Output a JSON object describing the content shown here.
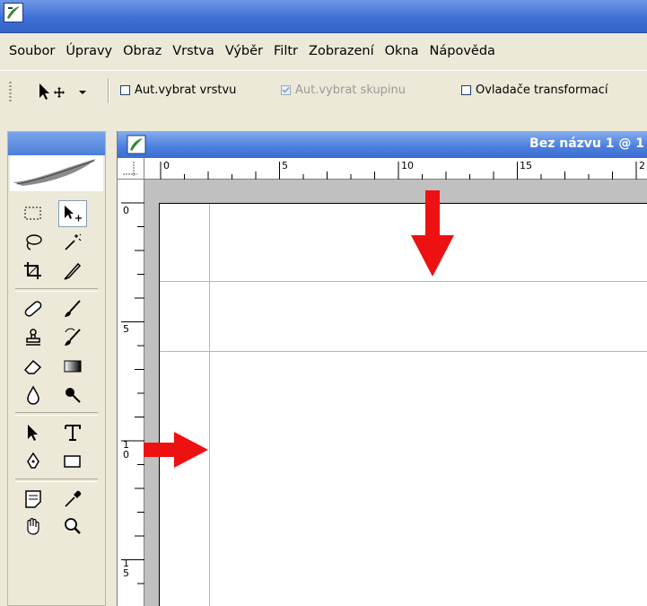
{
  "menu": [
    "Soubor",
    "Úpravy",
    "Obraz",
    "Vrstva",
    "Výběr",
    "Filtr",
    "Zobrazení",
    "Okna",
    "Nápověda"
  ],
  "options": {
    "auto_select_layer": "Aut.vybrat vrstvu",
    "auto_select_group": "Aut.vybrat skupinu",
    "transform_controls": "Ovladače transformací"
  },
  "document": {
    "title": "Bez názvu 1 @ 1"
  },
  "rulers": {
    "horizontal_labels": [
      "0",
      "5",
      "10",
      "15",
      "2"
    ],
    "vertical_labels": [
      "0",
      "5",
      "1\n0",
      "1\n5"
    ]
  },
  "colors": {
    "title_bar": "#3f6fd4",
    "guide": "#41e8e8",
    "arrow": "#ee1111",
    "chrome": "#ece9d8"
  },
  "icons": [
    "marquee-icon",
    "move-icon",
    "lasso-icon",
    "magic-wand-icon",
    "crop-icon",
    "slice-icon",
    "healing-brush-icon",
    "brush-icon",
    "stamp-icon",
    "history-brush-icon",
    "eraser-icon",
    "gradient-icon",
    "blur-icon",
    "dodge-icon",
    "path-select-icon",
    "type-icon",
    "pen-icon",
    "shape-icon",
    "notes-icon",
    "eyedropper-icon",
    "hand-icon",
    "zoom-icon"
  ]
}
